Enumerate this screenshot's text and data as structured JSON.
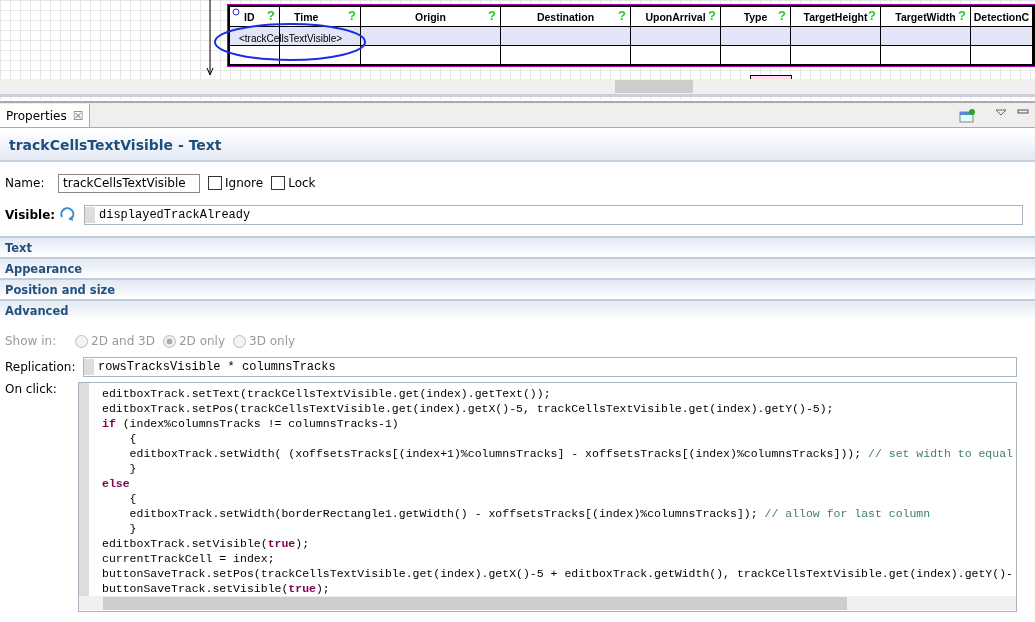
{
  "canvas": {
    "table": {
      "columns": [
        {
          "label": "ID",
          "mark": "?"
        },
        {
          "label": "Time",
          "mark": "?"
        },
        {
          "label": "Origin",
          "mark": "?"
        },
        {
          "label": "Destination",
          "mark": "?"
        },
        {
          "label": "UponArrival",
          "mark": "?"
        },
        {
          "label": "Type",
          "mark": "?"
        },
        {
          "label": "TargetHeight",
          "mark": "?"
        },
        {
          "label": "TargetWidth",
          "mark": "?"
        },
        {
          "label": "DetectionC"
        }
      ],
      "cell": "<trackCellsTextVisible>"
    }
  },
  "panel": {
    "tab": {
      "label": "Properties",
      "close": "☒"
    },
    "title": "trackCellsTextVisible - Text",
    "name": {
      "label": "Name:",
      "value": "trackCellsTextVisible"
    },
    "checks": [
      {
        "label": "Ignore",
        "checked": false
      },
      {
        "label": "Lock",
        "checked": false
      }
    ],
    "visible": {
      "label": "Visible:",
      "value": "displayedTrackAlready"
    },
    "sections": [
      "Text",
      "Appearance",
      "Position and size",
      "Advanced"
    ],
    "show_in": {
      "label": "Show in:",
      "disabled": true,
      "options": [
        {
          "label": "2D and 3D",
          "selected": false
        },
        {
          "label": "2D only",
          "selected": true
        },
        {
          "label": "3D only",
          "selected": false
        }
      ]
    },
    "replication": {
      "label": "Replication:",
      "value": "rowsTracksVisible * columnsTracks"
    },
    "on_click": {
      "label": "On click:",
      "lines": [
        [
          {
            "kind": "code",
            "text": "editboxTrack.setText(trackCellsTextVisible.get(index).getText());"
          }
        ],
        [
          {
            "kind": "code",
            "text": "editboxTrack.setPos(trackCellsTextVisible.get(index).getX()-5, trackCellsTextVisible.get(index).getY()-5);"
          }
        ],
        [
          {
            "kind": "keyword",
            "text": "if"
          },
          {
            "kind": "code",
            "text": " (index%columnsTracks != columnsTracks-1)"
          }
        ],
        [
          {
            "kind": "code",
            "text": "    {"
          }
        ],
        [
          {
            "kind": "code",
            "text": "    editboxTrack.setWidth( (xoffsetsTracks[(index+1)%columnsTracks] - xoffsetsTracks[(index)%columnsTracks])); "
          },
          {
            "kind": "comment",
            "text": "// set width to equal"
          }
        ],
        [
          {
            "kind": "code",
            "text": "    }"
          }
        ],
        [
          {
            "kind": "keyword",
            "text": "else"
          }
        ],
        [
          {
            "kind": "code",
            "text": "    {"
          }
        ],
        [
          {
            "kind": "code",
            "text": "    editboxTrack.setWidth(borderRectangle1.getWidth() - xoffsetsTracks[(index)%columnsTracks]); "
          },
          {
            "kind": "comment",
            "text": "// allow for last column"
          }
        ],
        [
          {
            "kind": "code",
            "text": "    }"
          }
        ],
        [
          {
            "kind": "code",
            "text": "editboxTrack.setVisible("
          },
          {
            "kind": "keyword",
            "text": "true"
          },
          {
            "kind": "code",
            "text": ");"
          }
        ],
        [
          {
            "kind": "code",
            "text": "currentTrackCell = index;"
          }
        ],
        [
          {
            "kind": "code",
            "text": "buttonSaveTrack.setPos(trackCellsTextVisible.get(index).getX()-5 + editboxTrack.getWidth(), trackCellsTextVisible.get(index).getY()-"
          }
        ],
        [
          {
            "kind": "code",
            "text": "buttonSaveTrack.setVisible("
          },
          {
            "kind": "keyword",
            "text": "true"
          },
          {
            "kind": "code",
            "text": ");"
          }
        ]
      ]
    }
  }
}
